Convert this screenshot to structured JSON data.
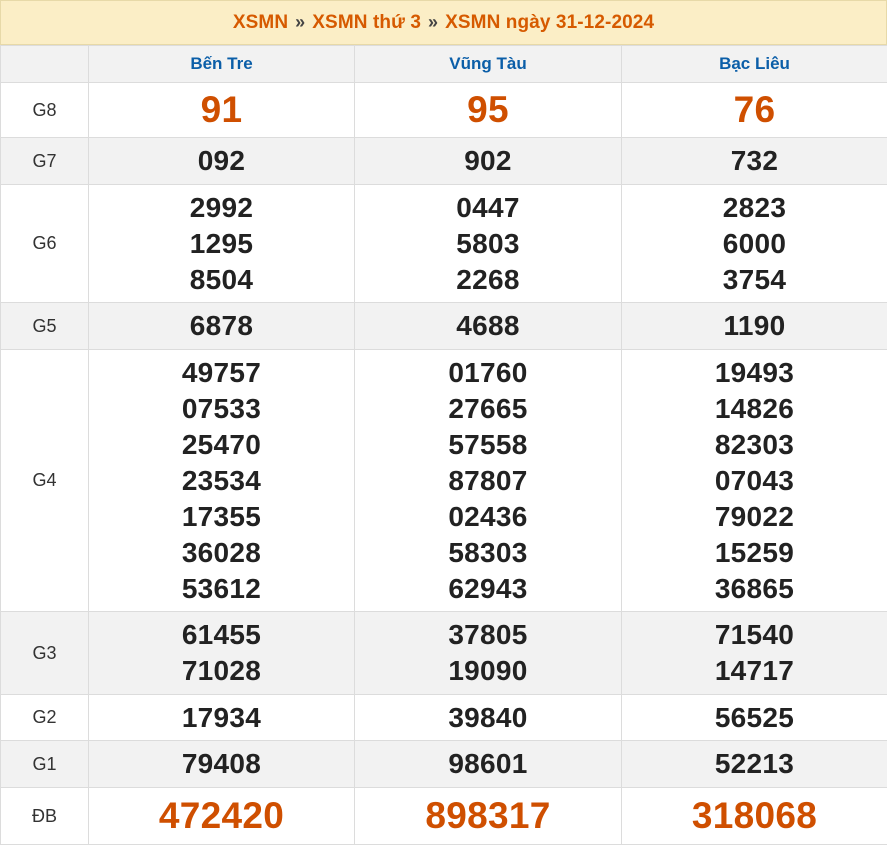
{
  "breadcrumb": {
    "item1": "XSMN",
    "item2": "XSMN thứ 3",
    "item3": "XSMN ngày 31-12-2024",
    "separator": "»"
  },
  "provinces": [
    "Bến Tre",
    "Vũng Tàu",
    "Bạc Liêu"
  ],
  "prizes": {
    "g8": {
      "label": "G8",
      "values": [
        [
          "91"
        ],
        [
          "95"
        ],
        [
          "76"
        ]
      ]
    },
    "g7": {
      "label": "G7",
      "values": [
        [
          "092"
        ],
        [
          "902"
        ],
        [
          "732"
        ]
      ]
    },
    "g6": {
      "label": "G6",
      "values": [
        [
          "2992",
          "1295",
          "8504"
        ],
        [
          "0447",
          "5803",
          "2268"
        ],
        [
          "2823",
          "6000",
          "3754"
        ]
      ]
    },
    "g5": {
      "label": "G5",
      "values": [
        [
          "6878"
        ],
        [
          "4688"
        ],
        [
          "1190"
        ]
      ]
    },
    "g4": {
      "label": "G4",
      "values": [
        [
          "49757",
          "07533",
          "25470",
          "23534",
          "17355",
          "36028",
          "53612"
        ],
        [
          "01760",
          "27665",
          "57558",
          "87807",
          "02436",
          "58303",
          "62943"
        ],
        [
          "19493",
          "14826",
          "82303",
          "07043",
          "79022",
          "15259",
          "36865"
        ]
      ]
    },
    "g3": {
      "label": "G3",
      "values": [
        [
          "61455",
          "71028"
        ],
        [
          "37805",
          "19090"
        ],
        [
          "71540",
          "14717"
        ]
      ]
    },
    "g2": {
      "label": "G2",
      "values": [
        [
          "17934"
        ],
        [
          "39840"
        ],
        [
          "56525"
        ]
      ]
    },
    "g1": {
      "label": "G1",
      "values": [
        [
          "79408"
        ],
        [
          "98601"
        ],
        [
          "52213"
        ]
      ]
    },
    "db": {
      "label": "ĐB",
      "values": [
        [
          "472420"
        ],
        [
          "898317"
        ],
        [
          "318068"
        ]
      ]
    }
  },
  "colors": {
    "accent": "#d65a00",
    "province": "#0b5ea8",
    "special": "#cf4f00"
  }
}
